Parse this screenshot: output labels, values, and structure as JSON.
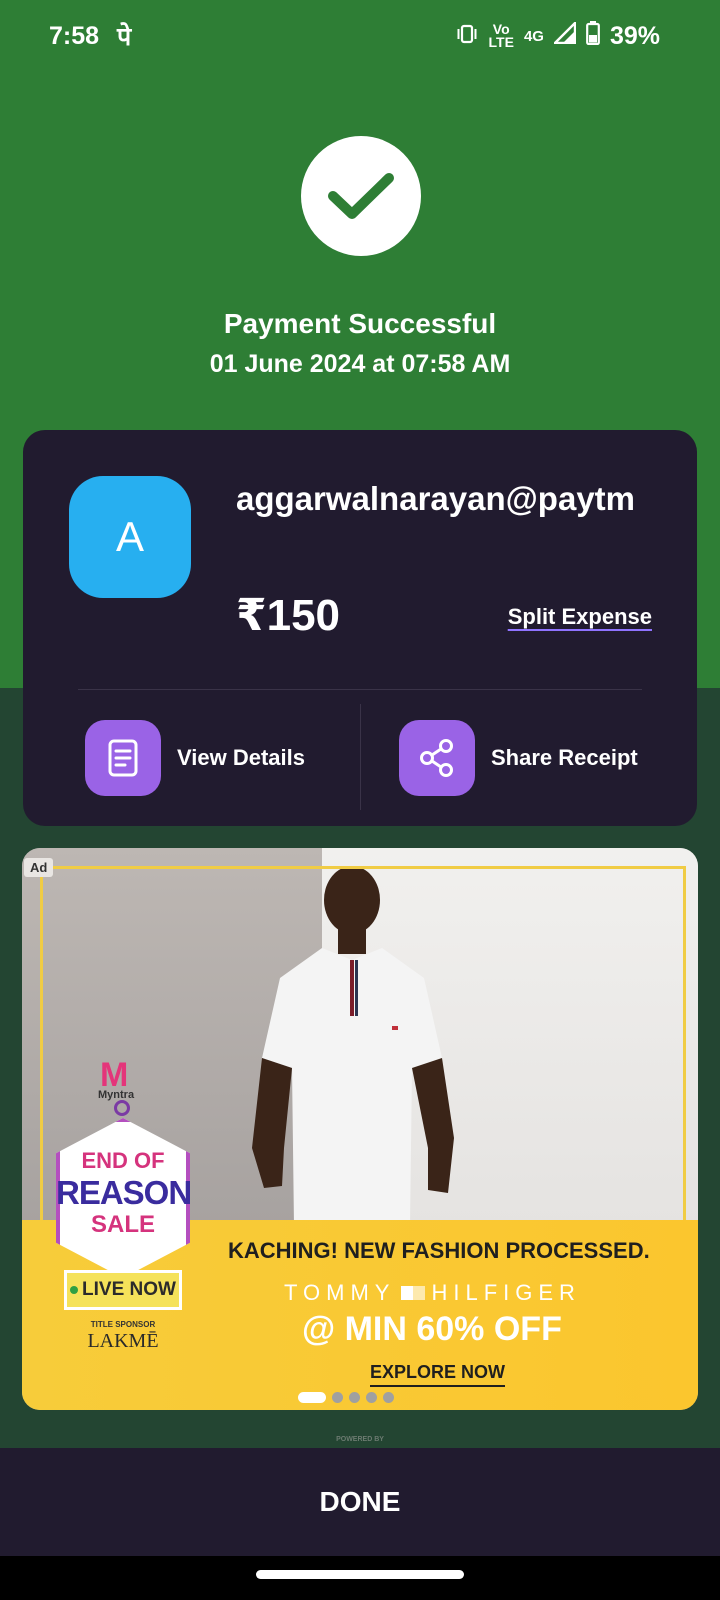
{
  "status_bar": {
    "time": "7:58",
    "carrier_glyph": "पे",
    "volte_top": "Vo",
    "volte_bottom": "LTE",
    "network": "4G",
    "battery": "39%",
    "icons": [
      "vibrate-icon",
      "signal-icon",
      "battery-icon"
    ]
  },
  "result": {
    "title": "Payment Successful",
    "datetime": "01 June 2024 at 07:58 AM",
    "icon": "checkmark-icon"
  },
  "payee": {
    "avatar_letter": "A",
    "vpa": "aggarwalnarayan@paytm",
    "amount": "₹150",
    "split_label": "Split Expense"
  },
  "actions": {
    "view_details": "View Details",
    "share_receipt": "Share Receipt"
  },
  "ad": {
    "label": "Ad",
    "brand": "Myntra",
    "sale_line1": "END OF",
    "sale_line2": "REASON",
    "sale_line3": "SALE",
    "live_now": "LIVE NOW",
    "sponsor_label": "TITLE SPONSOR",
    "sponsor": "LAKMĒ",
    "headline": "KACHING! NEW FASHION PROCESSED.",
    "brand_left": "TOMMY",
    "brand_right": "HILFIGER",
    "offer": "@ MIN 60% OFF",
    "cta": "EXPLORE NOW",
    "carousel_total": 6,
    "carousel_active": 1
  },
  "footer": {
    "powered": "POWERED BY",
    "done_label": "DONE"
  },
  "colors": {
    "header_green": "#2e7e35",
    "card_bg": "#211b2f",
    "avatar_blue": "#27aff0",
    "action_purple": "#9a63e6",
    "check_green": "#2e7e35"
  }
}
